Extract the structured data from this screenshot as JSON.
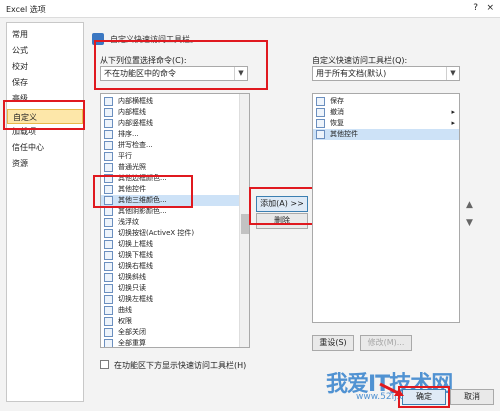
{
  "window": {
    "title": "Excel 选项",
    "help_icon": "?",
    "close_icon": "×"
  },
  "nav": {
    "items": [
      {
        "label": "常用"
      },
      {
        "label": "公式"
      },
      {
        "label": "校对"
      },
      {
        "label": "保存"
      },
      {
        "label": "高级"
      },
      {
        "label": "自定义"
      },
      {
        "label": "加载项"
      },
      {
        "label": "信任中心"
      },
      {
        "label": "资源"
      }
    ],
    "selected": "自定义"
  },
  "header": {
    "text": "自定义快速访问工具栏。"
  },
  "left": {
    "choose_label": "从下列位置选择命令(C):",
    "choose_value": "不在功能区中的命令",
    "commands": [
      {
        "label": "内部横框线",
        "icon": "border-inside-horizontal-icon"
      },
      {
        "label": "内部框线",
        "icon": "border-inside-icon"
      },
      {
        "label": "内部竖框线",
        "icon": "border-inside-vertical-icon"
      },
      {
        "label": "排序...",
        "icon": "sort-icon"
      },
      {
        "label": "拼写检查...",
        "icon": "spelling-icon"
      },
      {
        "label": "平行",
        "icon": "parallel-icon"
      },
      {
        "label": "普通光照",
        "icon": "lighting-icon"
      },
      {
        "label": "其他边框颜色...",
        "icon": "border-color-icon"
      },
      {
        "label": "其他控件",
        "icon": "other-controls-icon"
      },
      {
        "label": "其他三维颜色...",
        "icon": "3d-color-icon"
      },
      {
        "label": "其他阴影颜色...",
        "icon": "shadow-color-icon"
      },
      {
        "label": "浅浮纹",
        "icon": "shallow-emboss-icon"
      },
      {
        "label": "切换按钮(ActiveX 控件)",
        "icon": "toggle-button-icon"
      },
      {
        "label": "切换上框线",
        "icon": "border-top-icon"
      },
      {
        "label": "切换下框线",
        "icon": "border-bottom-icon"
      },
      {
        "label": "切换右框线",
        "icon": "border-right-icon"
      },
      {
        "label": "切换斜线",
        "icon": "border-diagonal-icon"
      },
      {
        "label": "切换只读",
        "icon": "readonly-icon"
      },
      {
        "label": "切换左框线",
        "icon": "border-left-icon"
      },
      {
        "label": "曲线",
        "icon": "curve-icon"
      },
      {
        "label": "权限",
        "icon": "permission-icon"
      },
      {
        "label": "全部关闭",
        "icon": "close-all-icon"
      },
      {
        "label": "全部重算",
        "icon": "recalculate-icon"
      }
    ],
    "selected_index": 9
  },
  "middle": {
    "add_label": "添加(A) >>",
    "remove_label": "删除"
  },
  "right": {
    "qat_label": "自定义快速访问工具栏(Q):",
    "qat_value": "用于所有文档(默认)",
    "items": [
      {
        "label": "保存",
        "icon": "save-icon"
      },
      {
        "label": "撤消",
        "icon": "undo-icon"
      },
      {
        "label": "恢复",
        "icon": "redo-icon"
      },
      {
        "label": "其他控件",
        "icon": "other-controls-icon"
      }
    ],
    "selected_index": 3,
    "reset_label": "重设(S)",
    "modify_label": "修改(M)..."
  },
  "show_below_label": "在功能区下方显示快速访问工具栏(H)",
  "footer": {
    "ok_label": "确定",
    "cancel_label": "取消"
  },
  "watermark": {
    "text": "我爱IT技术网",
    "url": "www.52ij.com"
  },
  "colors": {
    "highlight": "#e0191f",
    "selected_nav": "#fde7a9",
    "accent_blue": "#3b77c2"
  }
}
